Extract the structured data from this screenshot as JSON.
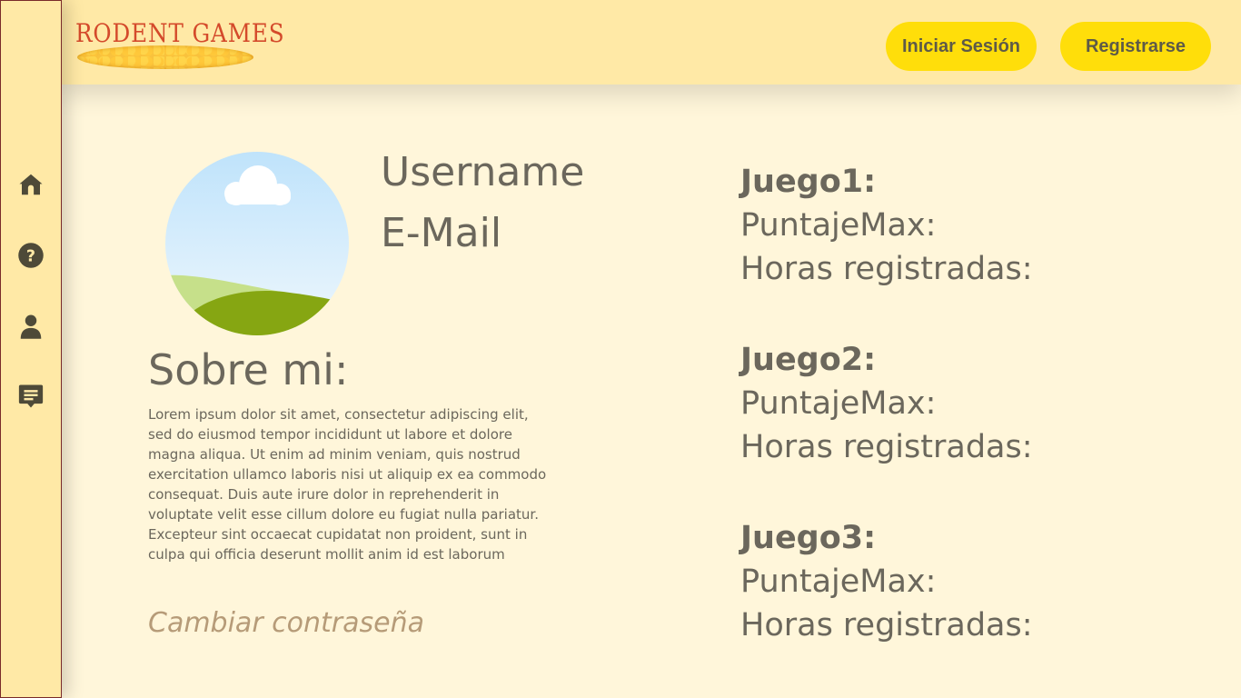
{
  "header": {
    "logo_text": "RODENT GAMES",
    "login_label": "Iniciar Sesión",
    "register_label": "Registrarse"
  },
  "sidebar": {
    "items": [
      {
        "icon": "home-icon"
      },
      {
        "icon": "help-icon"
      },
      {
        "icon": "user-icon"
      },
      {
        "icon": "chat-icon"
      }
    ]
  },
  "profile": {
    "username": "Username",
    "email": "E-Mail",
    "about_title": "Sobre mi:",
    "about_text": "Lorem ipsum dolor sit amet, consectetur adipiscing elit, sed do eiusmod tempor incididunt ut labore et dolore magna aliqua. Ut enim ad minim veniam, quis nostrud exercitation ullamco laboris nisi ut aliquip ex ea commodo consequat. Duis aute irure dolor in reprehenderit in voluptate velit esse cillum dolore eu fugiat nulla pariatur. Excepteur sint occaecat cupidatat non proident, sunt in culpa qui officia deserunt mollit anim id est laborum",
    "change_password": "Cambiar contraseña"
  },
  "games": [
    {
      "title": "Juego1:",
      "score_label": "PuntajeMax:",
      "hours_label": "Horas registradas:"
    },
    {
      "title": "Juego2:",
      "score_label": "PuntajeMax:",
      "hours_label": "Horas registradas:"
    },
    {
      "title": "Juego3:",
      "score_label": "PuntajeMax:",
      "hours_label": "Horas registradas:"
    }
  ],
  "colors": {
    "header_bg": "#ffe9a6",
    "page_bg": "#fff6da",
    "button_bg": "#ffde0a",
    "text": "#6b675c",
    "link": "#b69b78"
  }
}
